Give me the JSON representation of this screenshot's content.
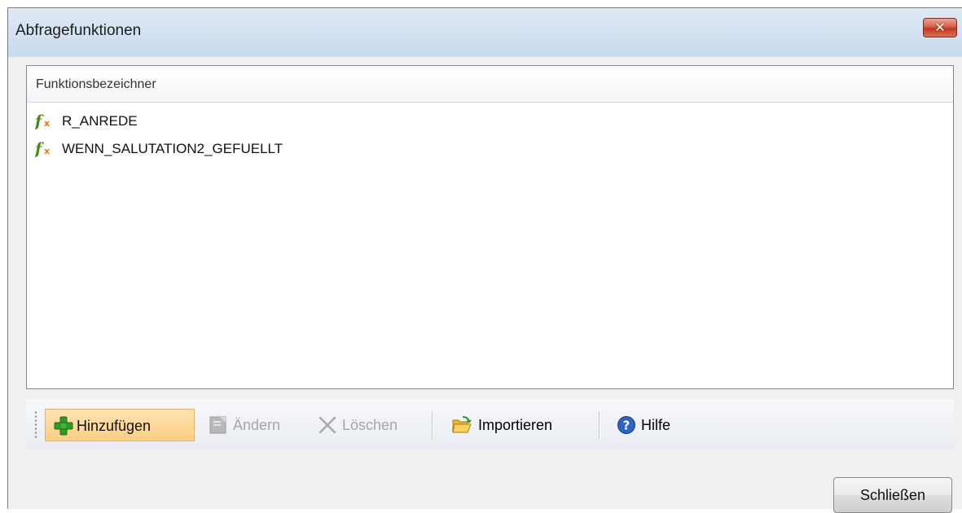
{
  "window": {
    "title": "Abfragefunktionen"
  },
  "list": {
    "column_header": "Funktionsbezeichner",
    "items": [
      {
        "icon": "function-icon",
        "label": "R_ANREDE"
      },
      {
        "icon": "function-icon",
        "label": "WENN_SALUTATION2_GEFUELLT"
      }
    ]
  },
  "toolbar": {
    "add_label": "Hinzufügen",
    "edit_label": "Ändern",
    "delete_label": "Löschen",
    "import_label": "Importieren",
    "help_label": "Hilfe"
  },
  "footer": {
    "close_label": "Schließen"
  },
  "colors": {
    "title_bar": "#d3e1f1",
    "close_button": "#c2381d",
    "active_button": "#fccf83",
    "function_icon": "#4a8a0c"
  }
}
